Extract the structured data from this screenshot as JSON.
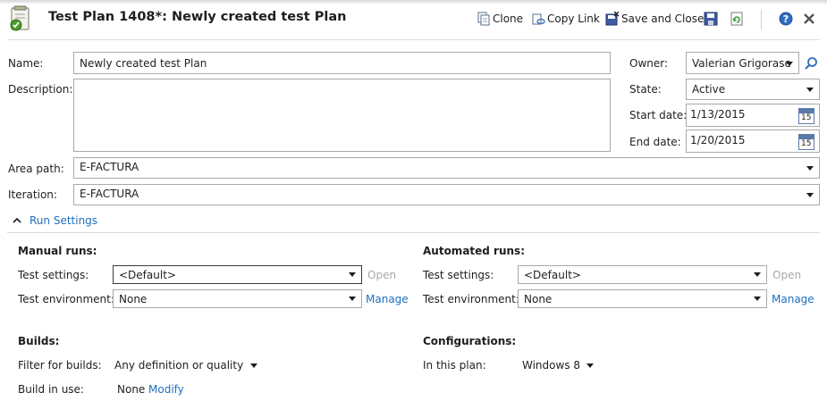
{
  "header": {
    "title": "Test Plan 1408*: Newly created test Plan",
    "toolbar": {
      "clone_label": "Clone",
      "copy_link_label": "Copy Link",
      "save_close_label": "Save and Close"
    }
  },
  "form": {
    "name_label": "Name:",
    "name_value": "Newly created test Plan",
    "description_label": "Description:",
    "description_value": "",
    "owner_label": "Owner:",
    "owner_value": "Valerian Grigorase",
    "state_label": "State:",
    "state_value": "Active",
    "start_date_label": "Start date:",
    "start_date_value": "1/13/2015",
    "end_date_label": "End date:",
    "end_date_value": "1/20/2015",
    "calendar_day": "15",
    "area_path_label": "Area path:",
    "area_path_value": "E-FACTURA",
    "iteration_label": "Iteration:",
    "iteration_value": "E-FACTURA"
  },
  "run_settings": {
    "toggle_label": "Run Settings",
    "manual": {
      "heading": "Manual runs:",
      "test_settings_label": "Test settings:",
      "test_settings_value": "<Default>",
      "open_label": "Open",
      "test_env_label": "Test environment:",
      "test_env_value": "None",
      "manage_label": "Manage"
    },
    "automated": {
      "heading": "Automated runs:",
      "test_settings_label": "Test settings:",
      "test_settings_value": "<Default>",
      "open_label": "Open",
      "test_env_label": "Test environment:",
      "test_env_value": "None",
      "manage_label": "Manage"
    }
  },
  "builds": {
    "heading": "Builds:",
    "filter_label": "Filter for builds:",
    "filter_value": "Any definition or quality",
    "build_in_use_label": "Build in use:",
    "build_in_use_value": "None",
    "modify_label": "Modify"
  },
  "configurations": {
    "heading": "Configurations:",
    "in_plan_label": "In this plan:",
    "in_plan_value": "Windows 8"
  },
  "colors": {
    "link": "#1f6fbf",
    "disabled": "#a8a8a8",
    "border": "#a9a9a9"
  }
}
